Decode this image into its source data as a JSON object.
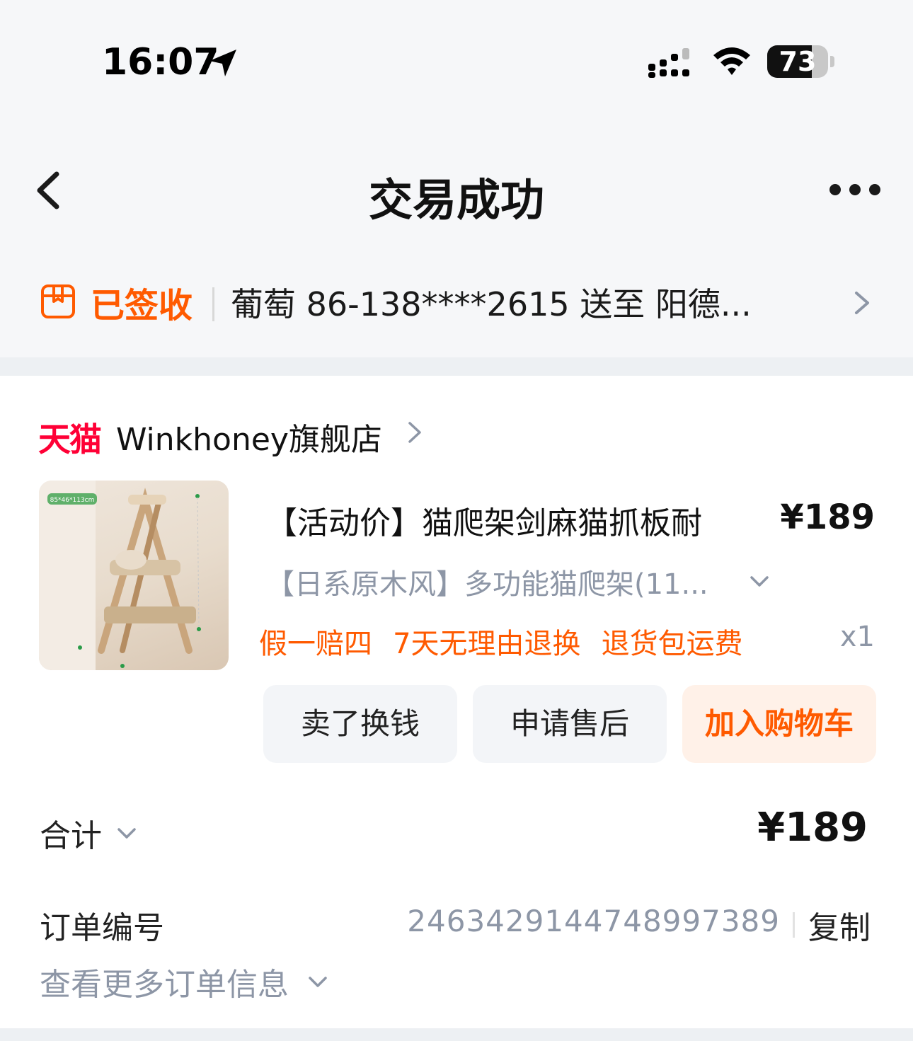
{
  "status_bar": {
    "time": "16:07",
    "battery": "73",
    "battery_level": 0.73,
    "icons": [
      "location-arrow-icon",
      "signal-icon",
      "wifi-icon",
      "battery-icon"
    ]
  },
  "nav": {
    "title": "交易成功",
    "icons": [
      "back-chevron-icon",
      "more-dots-icon"
    ]
  },
  "delivery": {
    "status": "已签收",
    "info": "葡萄  86-138****2615  送至  阳德...",
    "icons": [
      "package-icon",
      "chevron-right-icon"
    ]
  },
  "store": {
    "platform": "天猫",
    "name": "Winkhoney旗舰店"
  },
  "product": {
    "title": "【活动价】猫爬架剑麻猫抓板耐",
    "price": "¥189",
    "variant": "【日系原木风】多功能猫爬架(11...",
    "guarantees": [
      "假一赔四",
      "7天无理由退换",
      "退货包运费"
    ],
    "quantity": "x1",
    "image_label": "85*46*113cm"
  },
  "actions": {
    "sell": "卖了换钱",
    "after_sale": "申请售后",
    "add_to_cart": "加入购物车"
  },
  "summary": {
    "total_label": "合计",
    "total_value": "¥189",
    "order_label": "订单编号",
    "order_number": "2463429144748997389",
    "copy_label": "复制",
    "more_info": "查看更多订单信息"
  },
  "colors": {
    "accent_orange": "#ff5a00",
    "tmall_red": "#ff0036",
    "muted_gray": "#8d96a6",
    "page_bg": "#f6f7f9"
  }
}
